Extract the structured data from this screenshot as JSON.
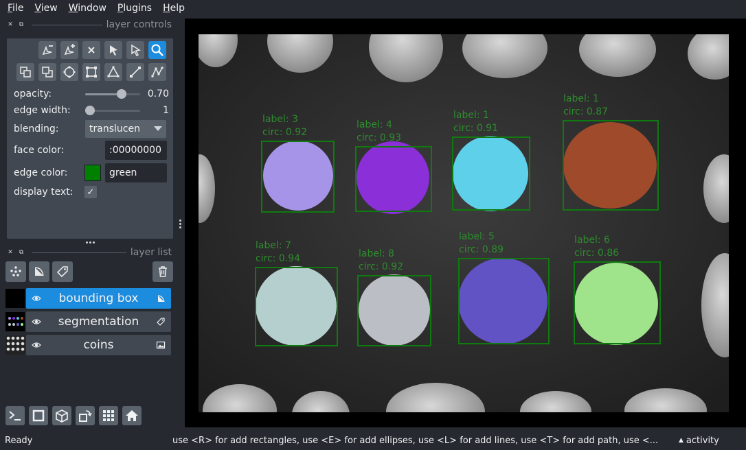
{
  "menubar": {
    "items": [
      {
        "label": "File",
        "accel": "F",
        "rest": "ile"
      },
      {
        "label": "View",
        "accel": "V",
        "rest": "iew"
      },
      {
        "label": "Window",
        "accel": "W",
        "rest": "indow"
      },
      {
        "label": "Plugins",
        "accel": "P",
        "rest": "lugins"
      },
      {
        "label": "Help",
        "accel": "H",
        "rest": "elp"
      }
    ]
  },
  "layer_controls": {
    "title": "layer controls",
    "opacity_label": "opacity:",
    "opacity_value": "0.70",
    "opacity_fraction": 0.7,
    "edge_width_label": "edge width:",
    "edge_width_value": "1",
    "edge_width_fraction": 0.0,
    "blending_label": "blending:",
    "blending_value": "translucen",
    "face_color_label": "face color:",
    "face_color_value": ":00000000",
    "edge_color_label": "edge color:",
    "edge_color_value": "green",
    "edge_color_hex": "#008000",
    "display_text_label": "display text:",
    "display_text_checked": true,
    "check_glyph": "✓"
  },
  "layer_list": {
    "title": "layer list",
    "layers": [
      {
        "name": "bounding box",
        "selected": true,
        "kind_icon": "shapes-icon"
      },
      {
        "name": "segmentation",
        "selected": false,
        "kind_icon": "labels-icon"
      },
      {
        "name": "coins",
        "selected": false,
        "kind_icon": "image-icon"
      }
    ]
  },
  "annotations": [
    {
      "label": "label: 3",
      "circ": "circ: 0.92"
    },
    {
      "label": "label: 4",
      "circ": "circ: 0.93"
    },
    {
      "label": "label: 1",
      "circ": "circ: 0.91"
    },
    {
      "label": "label: 1",
      "circ": "circ: 0.87"
    },
    {
      "label": "label: 7",
      "circ": "circ: 0.94"
    },
    {
      "label": "label: 8",
      "circ": "circ: 0.92"
    },
    {
      "label": "label: 5",
      "circ": "circ: 0.89"
    },
    {
      "label": "label: 6",
      "circ": "circ: 0.86"
    }
  ],
  "colors": {
    "accent": "#1c8cdf",
    "annotation_text": "#2e8b2e",
    "box": "#0f7a0f"
  },
  "statusbar": {
    "ready": "Ready",
    "hint": "use <R> for add rectangles, use <E> for add ellipses, use <L> for add lines, use <T> for add path, use <...",
    "activity": "activity",
    "activity_caret": "▲"
  }
}
